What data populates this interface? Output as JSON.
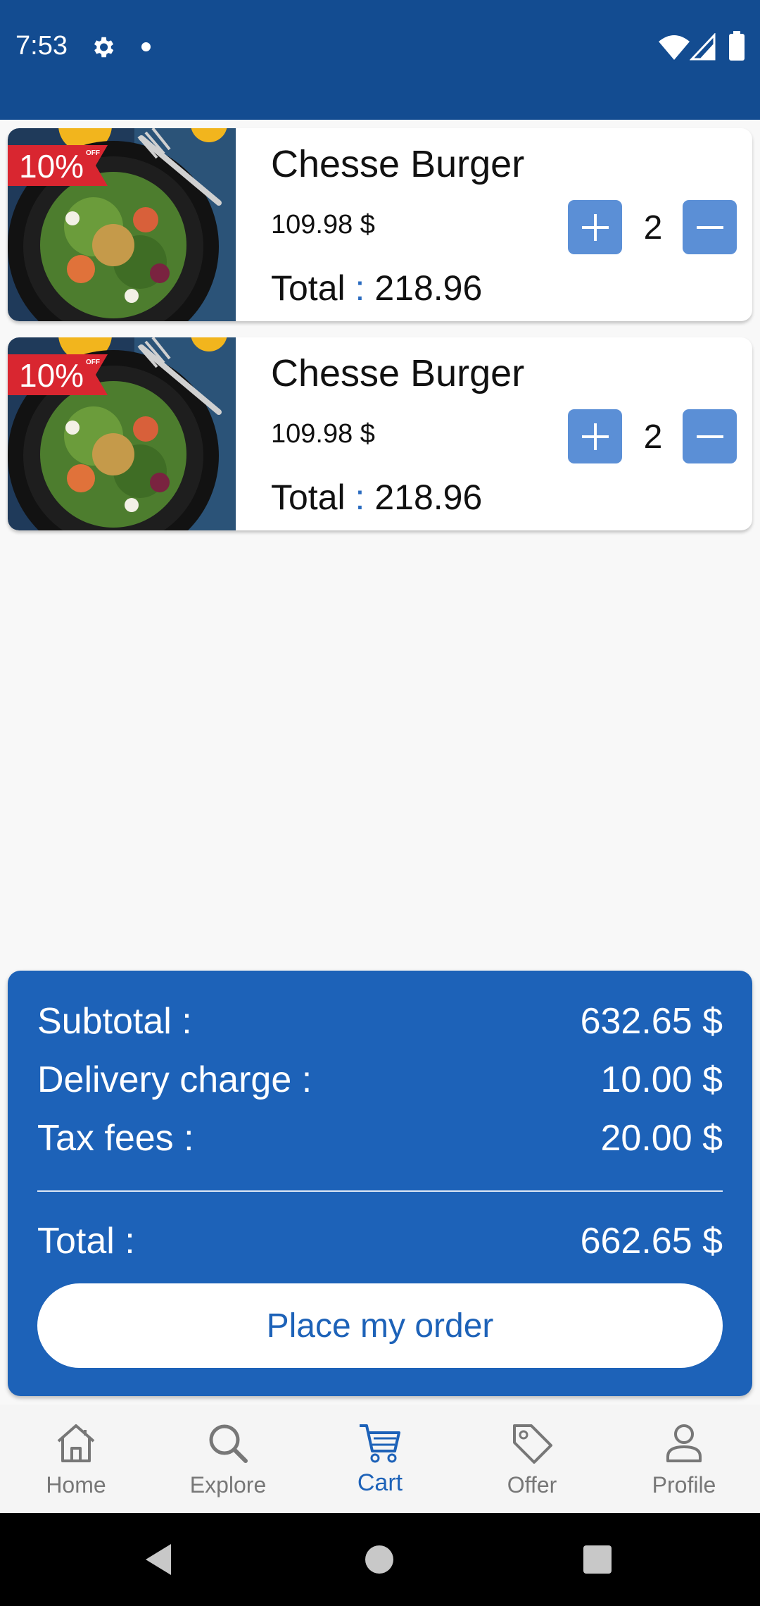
{
  "status_bar": {
    "time": "7:53",
    "icons": [
      "gear-icon",
      "notification-dot-icon",
      "wifi-icon",
      "signal-icon",
      "battery-icon"
    ]
  },
  "cart": {
    "items": [
      {
        "discount": "10%",
        "discount_tag": "OFF",
        "name": "Chesse Burger",
        "price": "109.98 $",
        "total_label": "Total",
        "total_separator": ":",
        "total_value": "218.96",
        "quantity": "2"
      },
      {
        "discount": "10%",
        "discount_tag": "OFF",
        "name": "Chesse Burger",
        "price": "109.98 $",
        "total_label": "Total",
        "total_separator": ":",
        "total_value": "218.96",
        "quantity": "2"
      }
    ]
  },
  "summary": {
    "subtotal_label": "Subtotal :",
    "subtotal_value": "632.65 $",
    "delivery_label": "Delivery charge :",
    "delivery_value": "10.00 $",
    "tax_label": "Tax fees :",
    "tax_value": "20.00 $",
    "total_label": "Total :",
    "total_value": "662.65 $",
    "order_button": "Place my order"
  },
  "bottom_nav": {
    "items": [
      {
        "label": "Home",
        "icon": "home-icon"
      },
      {
        "label": "Explore",
        "icon": "search-icon"
      },
      {
        "label": "Cart",
        "icon": "cart-icon",
        "active": true
      },
      {
        "label": "Offer",
        "icon": "tag-icon"
      },
      {
        "label": "Profile",
        "icon": "profile-icon"
      }
    ]
  },
  "colors": {
    "status_bar": "#134c91",
    "primary": "#1d62b8",
    "qty_button": "#5b8fd6",
    "discount": "#d92630",
    "nav_inactive": "#777777"
  }
}
